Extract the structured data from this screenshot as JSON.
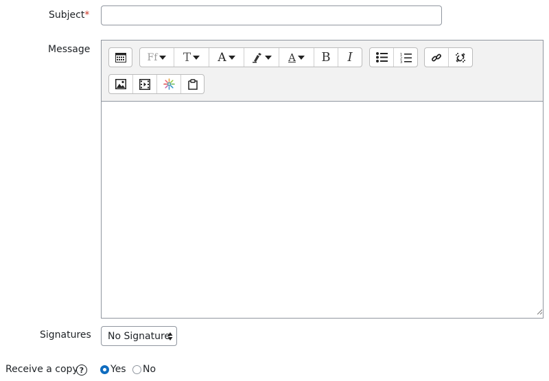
{
  "subject": {
    "label": "Subject",
    "required_mark": "*",
    "value": "",
    "placeholder": ""
  },
  "message": {
    "label": "Message",
    "toolbar": {
      "row1": [
        {
          "name": "toolbar-toggle-icon"
        },
        {
          "name": "font-family-icon",
          "text": "Ff"
        },
        {
          "name": "font-size-icon",
          "text": "T"
        },
        {
          "name": "font-color-icon",
          "text": "A"
        },
        {
          "name": "highlight-color-icon"
        },
        {
          "name": "text-style-icon",
          "text": "A"
        },
        {
          "name": "bold-icon",
          "text": "B"
        },
        {
          "name": "italic-icon",
          "text": "I"
        },
        {
          "name": "bullet-list-icon"
        },
        {
          "name": "numbered-list-icon"
        },
        {
          "name": "link-icon"
        },
        {
          "name": "unlink-icon"
        }
      ],
      "row2": [
        {
          "name": "image-icon"
        },
        {
          "name": "media-icon"
        },
        {
          "name": "h5p-icon"
        },
        {
          "name": "paste-icon"
        }
      ]
    },
    "body": ""
  },
  "signatures": {
    "label": "Signatures",
    "selected": "No Signature"
  },
  "receive_copy": {
    "label": "Receive a copy",
    "help_icon": "question-circle-icon",
    "options": [
      {
        "label": "Yes",
        "checked": true
      },
      {
        "label": "No",
        "checked": false
      }
    ]
  },
  "colors": {
    "accent": "#0f6cbf",
    "required": "#ca3120",
    "toolbar_bg": "#f2f2f2"
  }
}
